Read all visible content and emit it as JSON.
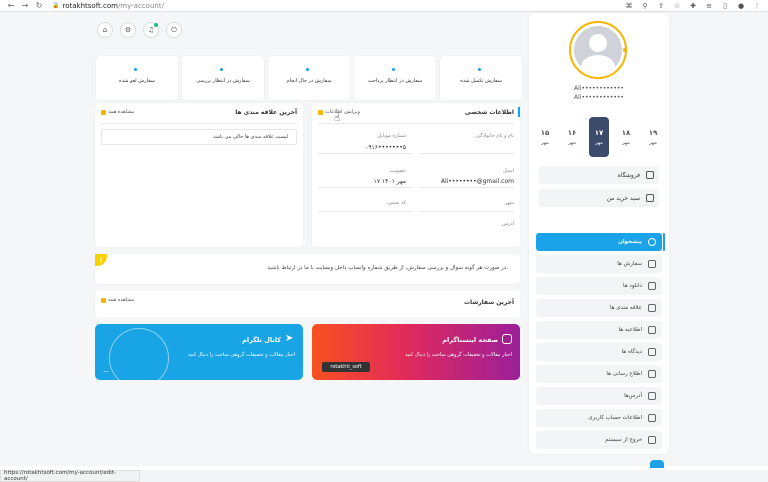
{
  "browser": {
    "domain": "rotakhtsoft.com",
    "path": "/my-account/"
  },
  "sidebar": {
    "user_line1": "Ali••••••••••••",
    "user_line2": "Ali••••••••••••",
    "dates": [
      {
        "num": "۱۵",
        "month": "مهر"
      },
      {
        "num": "۱۶",
        "month": "مهر"
      },
      {
        "num": "۱۷",
        "month": "مهر",
        "active": true
      },
      {
        "num": "۱۸",
        "month": "مهر"
      },
      {
        "num": "۱۹",
        "month": "مهر"
      }
    ],
    "shop_label": "فروشگاه",
    "cart_label": "سبد خرید من",
    "menu": [
      {
        "label": "پیشخوان",
        "active": true
      },
      {
        "label": "سفارش ها"
      },
      {
        "label": "دانلود ها"
      },
      {
        "label": "علاقه مندی ها"
      },
      {
        "label": "اطلاعیه ها"
      },
      {
        "label": "دیدگاه ها"
      },
      {
        "label": "اطلاع رسانی ها"
      },
      {
        "label": "آدرس‌ها"
      },
      {
        "label": "اطلاعات حساب کاربری"
      },
      {
        "label": "خروج از سیستم"
      }
    ]
  },
  "orders": [
    {
      "label": "سفارش تکمیل شده"
    },
    {
      "label": "سفارش در انتظار پرداخت"
    },
    {
      "label": "سفارش در حال انجام"
    },
    {
      "label": "سفارش در انتظار بررسی"
    },
    {
      "label": "سفارش لغو شده"
    }
  ],
  "personal": {
    "title": "اطلاعات شخصی",
    "edit_label": "ویرایش اطلاعات",
    "name_label": "نام و نام خانوادگی",
    "mobile_label": "شماره موبایل",
    "mobile_value": "۰۹۱۶•••••••۵",
    "email_label": "ایمیل",
    "email_value": "Ali••••••••@gmail.com",
    "membership_label": "عضویت",
    "membership_value": "۱۷ مهر ۱۴۰۱",
    "city_label": "شهر",
    "postal_label": "کد پستی",
    "address_label": "آدرس"
  },
  "favorites": {
    "title": "آخرین علاقه مندی ها",
    "see_all": "مشاهده همه",
    "empty": "لیست علاقه مندی ها خالی می باشد"
  },
  "notice": {
    "text": "در صورت هر گونه سوال و بررسی سفارش، از طریق شماره واتساپ داخل وبسایت با ما در ارتباط باشید."
  },
  "latest_orders": {
    "title": "آخرین سفارشات",
    "see_all": "مشاهده همه"
  },
  "instagram": {
    "title": "صفحه اینستاگرام",
    "desc": "اخبار مقالات و تخفیفات گروهی ساخت را دنبال کنید",
    "handle": "rotakhti_soft"
  },
  "telegram": {
    "title": "کانال تلگرام",
    "desc": "اخبار مقالات و تخفیفات گروهی ساخت را دنبال کنید",
    "dash": "—"
  },
  "status_bar": {
    "url": "https://rotakhtsoft.com/my-account/edit-account/"
  },
  "colors": {
    "accent": "#1aa3e8",
    "yellow": "#f7b500",
    "active_date": "#3c4a6b"
  }
}
